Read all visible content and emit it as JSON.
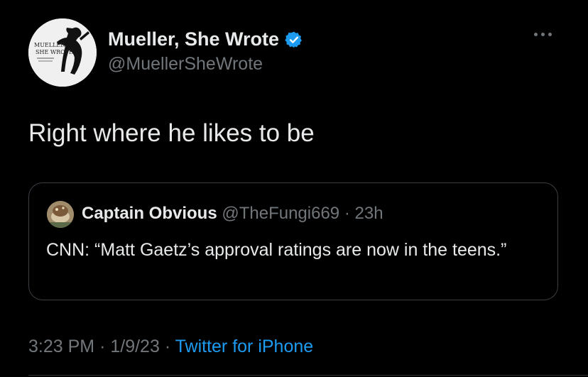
{
  "author": {
    "display_name": "Mueller, She Wrote",
    "handle": "@MuellerSheWrote",
    "avatar_text": "MUELLER SHE WROTE",
    "verified": true
  },
  "tweet": {
    "text": "Right where he likes to be"
  },
  "quoted_tweet": {
    "display_name": "Captain Obvious",
    "handle": "@TheFungi669",
    "separator": "·",
    "time": "23h",
    "text": "CNN: “Matt Gaetz’s approval ratings are now in the teens.”"
  },
  "meta": {
    "time": "3:23 PM",
    "separator": "·",
    "date": "1/9/23",
    "source": "Twitter for iPhone"
  },
  "icons": {
    "more": "more-horizontal-icon",
    "verified": "verified-badge-icon"
  },
  "colors": {
    "background": "#000000",
    "text": "#e7e9ea",
    "secondary": "#71767b",
    "link": "#1d9bf0",
    "border": "#3a3f44"
  }
}
